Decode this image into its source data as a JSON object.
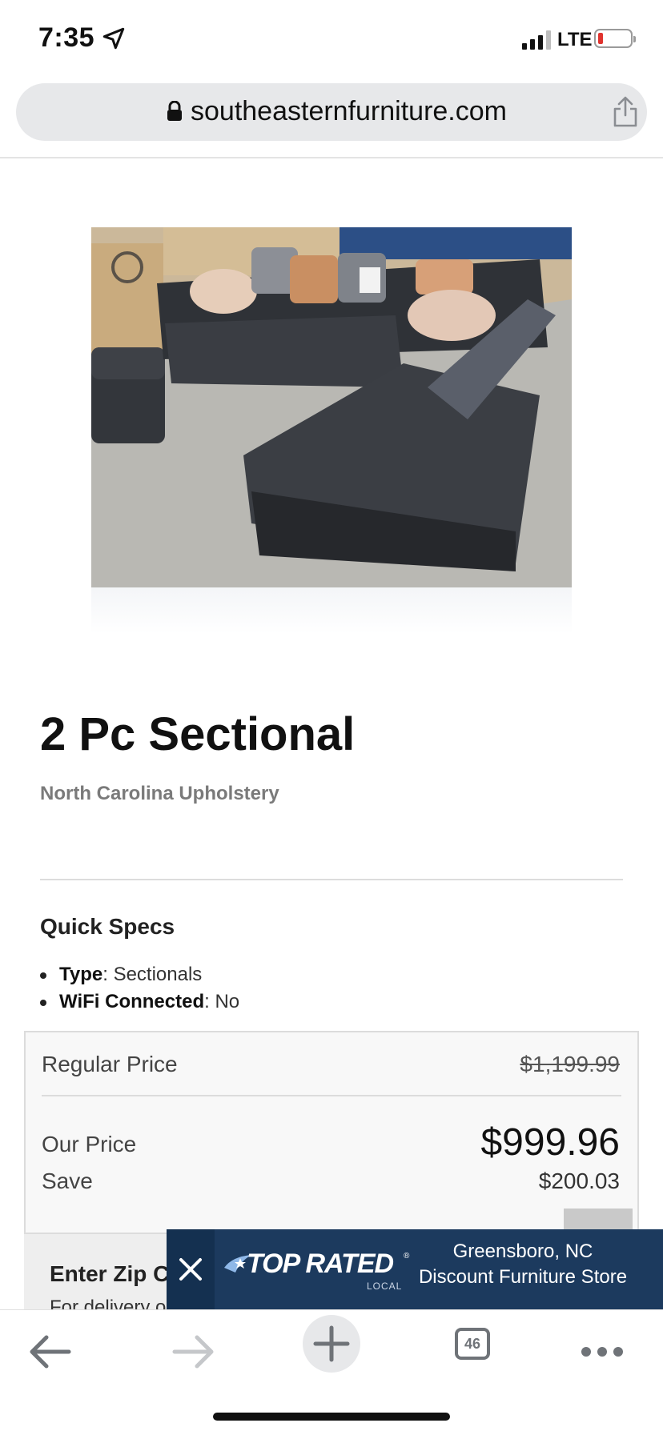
{
  "status_bar": {
    "time": "7:35",
    "network": "LTE",
    "battery_level": 0.1
  },
  "browser": {
    "url": "southeasternfurniture.com",
    "tab_count": "46"
  },
  "product": {
    "image_alt": "2 Pc Sectional",
    "title": "2 Pc Sectional",
    "brand": "North Carolina Upholstery"
  },
  "quick_specs": {
    "heading": "Quick Specs",
    "items": [
      {
        "key": "Type",
        "value": ": Sectionals"
      },
      {
        "key": "WiFi Connected",
        "value": ": No"
      }
    ]
  },
  "pricing": {
    "regular_label": "Regular Price",
    "regular_value": "$1,199.99",
    "our_label": "Our Price",
    "our_value": "$999.96",
    "save_label": "Save",
    "save_value": "$200.03"
  },
  "zip": {
    "heading": "Enter Zip C",
    "subtext": "For delivery o"
  },
  "ad": {
    "logo": "TOP RATED",
    "logo_sub": "LOCAL",
    "line1": "Greensboro, NC",
    "line2": "Discount Furniture Store"
  },
  "colors": {
    "ad_bg": "#1c3a5e",
    "battery_low": "#e0332e",
    "toolbar_icon": "#6f7378"
  }
}
